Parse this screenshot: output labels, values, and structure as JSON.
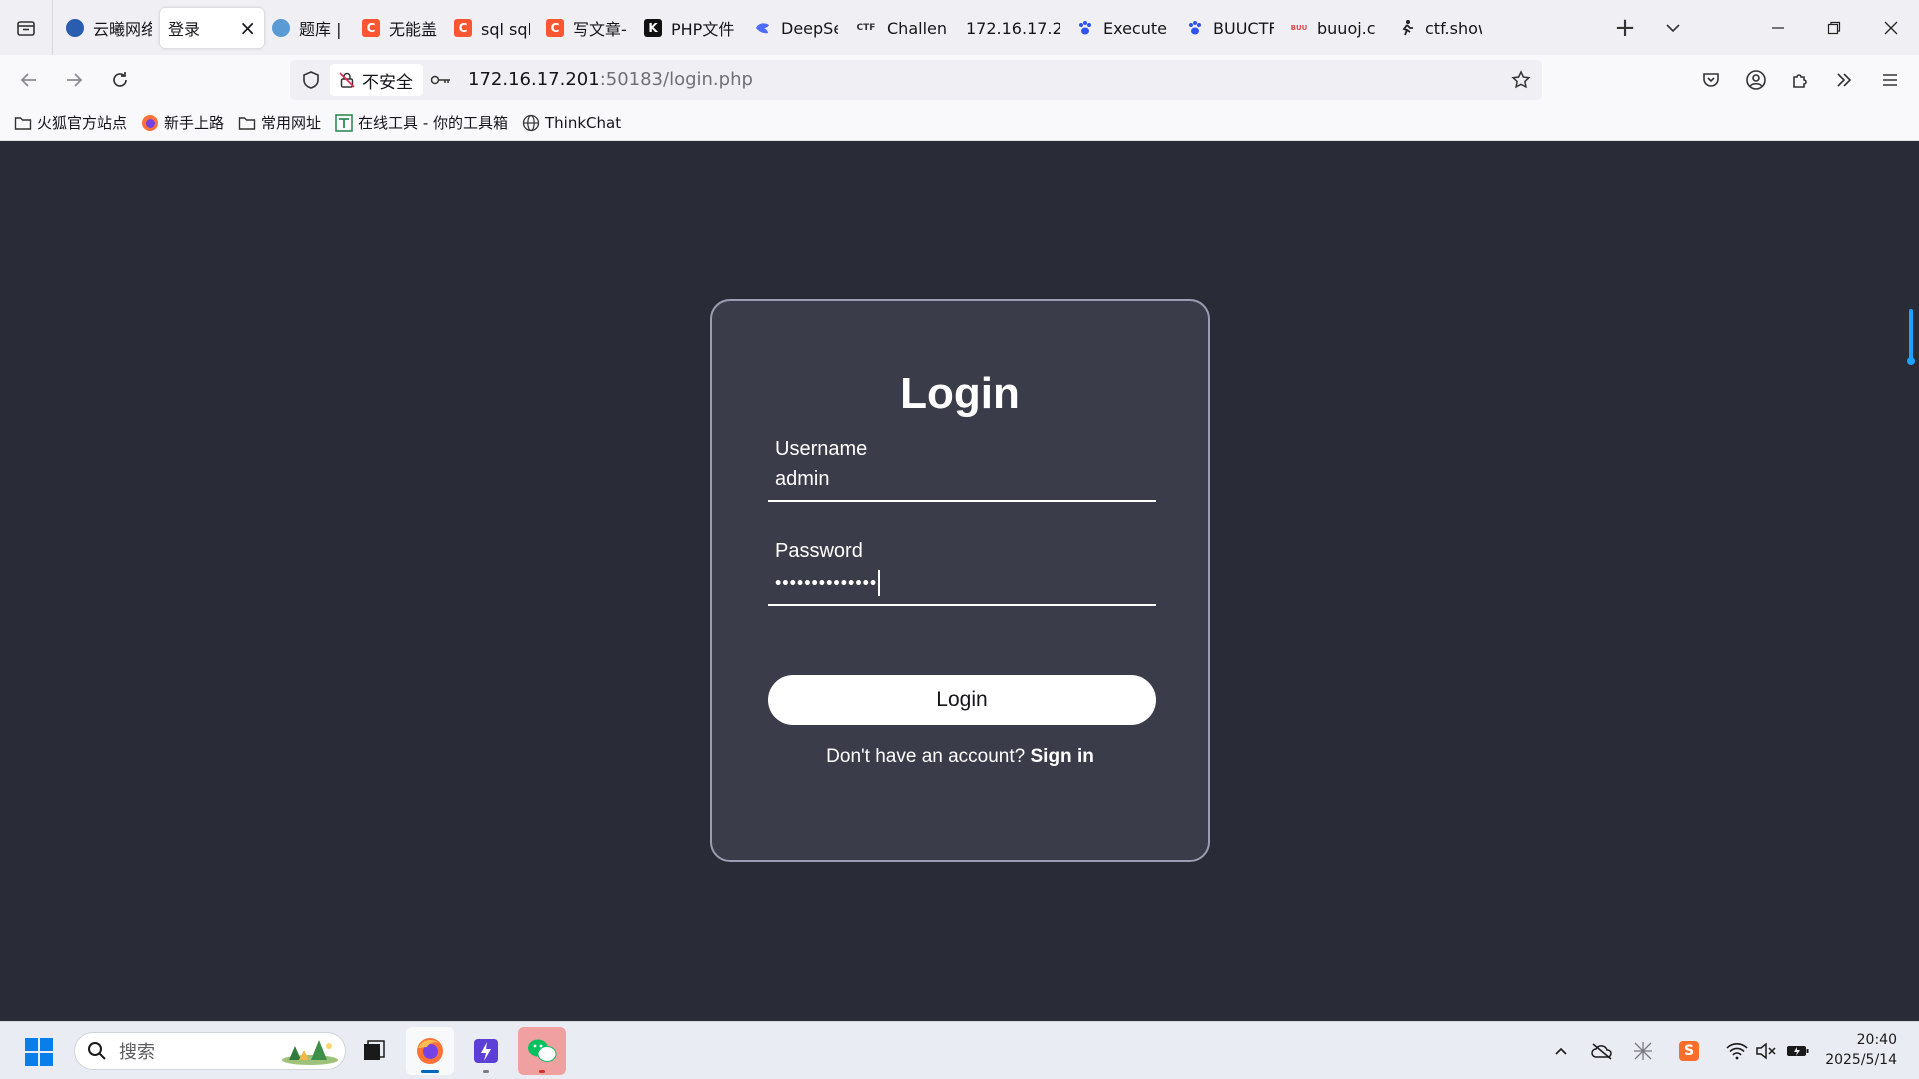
{
  "browser": {
    "tabs": [
      {
        "title": "云曦网络",
        "icon": "cloud-favicon-icon",
        "active": false
      },
      {
        "title": "登录",
        "icon": "none",
        "active": true
      },
      {
        "title": "题库 | N",
        "icon": "cloud-upload-favicon-icon",
        "active": false
      },
      {
        "title": "无能盖",
        "icon": "csdn-favicon-icon",
        "active": false
      },
      {
        "title": "sql sql集",
        "icon": "csdn-favicon-icon",
        "active": false
      },
      {
        "title": "写文章-",
        "icon": "csdn-favicon-icon",
        "active": false
      },
      {
        "title": "PHP文件",
        "icon": "k-favicon-icon",
        "active": false
      },
      {
        "title": "DeepSe",
        "icon": "deepseek-favicon-icon",
        "active": false
      },
      {
        "title": "Challen",
        "icon": "ctf-favicon-icon",
        "active": false
      },
      {
        "title": "172.16.17.2",
        "icon": "none",
        "active": false
      },
      {
        "title": "Execute",
        "icon": "paw-favicon-icon",
        "active": false
      },
      {
        "title": "BUUCTF",
        "icon": "paw-favicon-icon",
        "active": false
      },
      {
        "title": "buuoj.c",
        "icon": "buu-favicon-icon",
        "active": false
      },
      {
        "title": "ctf.show",
        "icon": "runner-favicon-icon",
        "active": false
      }
    ],
    "favicon_labels": {
      "csdn": "C",
      "k": "K",
      "ctf": "CTF",
      "buu": "BUU"
    },
    "security_label": "不安全",
    "url_host": "172.16.17.201",
    "url_rest": ":50183/login.php",
    "bookmarks": [
      {
        "label": "火狐官方站点",
        "icon": "folder-icon"
      },
      {
        "label": "新手上路",
        "icon": "firefox-icon"
      },
      {
        "label": "常用网址",
        "icon": "folder-icon"
      },
      {
        "label": "在线工具 - 你的工具箱",
        "icon": "tool-icon"
      },
      {
        "label": "ThinkChat",
        "icon": "globe-icon"
      }
    ]
  },
  "page": {
    "title": "Login",
    "username_label": "Username",
    "username_value": "admin",
    "password_label": "Password",
    "password_mask": "••••••••••••••",
    "login_button": "Login",
    "signup_prompt": "Don't have an account?",
    "signup_link": "Sign in"
  },
  "taskbar": {
    "search_placeholder": "搜索",
    "time": "20:40",
    "date": "2025/5/14",
    "tray_sogou": "S"
  },
  "colors": {
    "page_bg": "#292b37",
    "card_bg": "#3b3c4a",
    "card_border": "#9c9db0",
    "accent_scroll": "#1ea1ff"
  }
}
